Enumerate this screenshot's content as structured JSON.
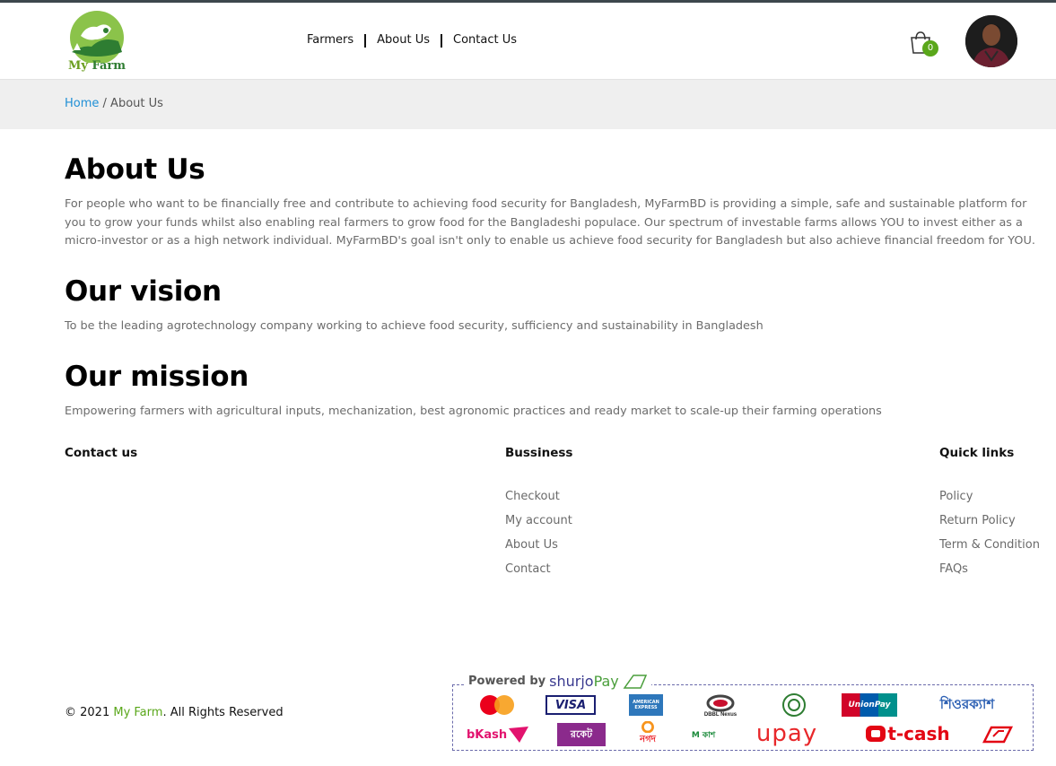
{
  "header": {
    "logo_text_prefix": "My",
    "logo_text_suffix": " Farm",
    "nav": [
      {
        "label": "Farmers"
      },
      {
        "label": "About Us"
      },
      {
        "label": "Contact Us"
      }
    ],
    "cart_count": "0"
  },
  "breadcrumb": {
    "home": "Home",
    "separator": " / ",
    "current": "About Us"
  },
  "sections": {
    "about": {
      "title": "About Us",
      "text": "For people who want to be financially free and contribute to achieving food security for Bangladesh, MyFarmBD is providing a simple, safe and sustainable platform for you to grow your funds whilst also enabling real farmers to grow food for the Bangladeshi populace. Our spectrum of investable farms allows YOU to invest either as a micro-investor or as a high network individual. MyFarmBD's goal isn't only to enable us achieve food security for Bangladesh but also achieve financial freedom for YOU."
    },
    "vision": {
      "title": "Our vision",
      "text": "To be the leading agrotechnology company working to achieve food security, sufficiency and sustainability in Bangladesh"
    },
    "mission": {
      "title": "Our mission",
      "text": "Empowering farmers with agricultural inputs, mechanization, best agronomic practices and ready market to scale-up their farming operations"
    }
  },
  "footer": {
    "contact_title": "Contact us",
    "business_title": "Bussiness",
    "business_links": [
      "Checkout",
      "My account",
      "About Us",
      "Contact"
    ],
    "quick_title": "Quick links",
    "quick_links": [
      "Policy",
      "Return Policy",
      "Term & Condition",
      "FAQs"
    ],
    "copyright_prefix": "© 2021 ",
    "copyright_brand": "My Farm",
    "copyright_suffix": ". All Rights Reserved",
    "payment": {
      "powered_by": "Powered by",
      "brand_a": "shurjo",
      "brand_b": "Pay",
      "methods_row1": [
        "mastercard",
        "VISA",
        "AMERICAN EXPRESS",
        "DBBL Nexus",
        "bank-seal",
        "UnionPay",
        "শিওরক্যাশ"
      ],
      "methods_row2": [
        "bKash",
        "রকেট",
        "নগদ",
        "M কাশ",
        "upay",
        "t-cash",
        "ipay"
      ]
    }
  },
  "colors": {
    "accent_green": "#5aa71b",
    "link_blue": "#1f8fd6",
    "breadcrumb_bg": "#efefef",
    "text_muted": "#6c6c6c"
  }
}
